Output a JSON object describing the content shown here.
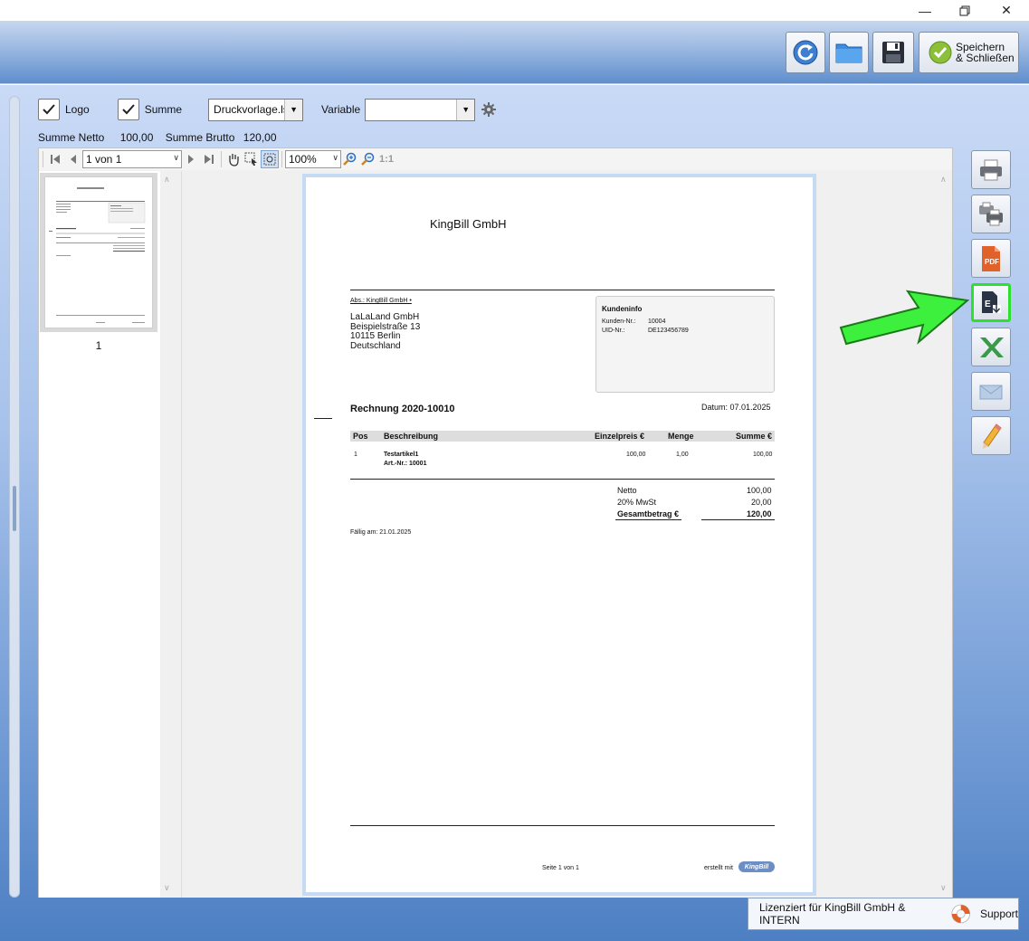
{
  "window": {
    "minimize": "—",
    "restore": "❐",
    "close": "✕"
  },
  "header": {
    "buttons": [
      "refresh-icon",
      "folder-icon",
      "save-icon"
    ],
    "save_close_line1": "Speichern",
    "save_close_line2": "& Schließen"
  },
  "options": {
    "logo_label": "Logo",
    "logo_checked": true,
    "summe_label": "Summe",
    "summe_checked": true,
    "template_value": "Druckvorlage.lst",
    "variable_label": "Variable",
    "variable_value": ""
  },
  "summary": {
    "netto_label": "Summe Netto",
    "netto_value": "100,00",
    "brutto_label": "Summe Brutto",
    "brutto_value": "120,00"
  },
  "preview_toolbar": {
    "page_value": "1 von 1",
    "zoom_value": "100%",
    "one_to_one": "1:1"
  },
  "thumbnails": {
    "page_number": "1"
  },
  "invoice": {
    "company": "KingBill GmbH",
    "sender_line": "Abs.: KingBill GmbH •",
    "recipient": [
      "LaLaLand GmbH",
      "Beispielstraße 13",
      "10115 Berlin",
      "Deutschland"
    ],
    "kundeninfo_title": "Kundeninfo",
    "kunden_nr_label": "Kunden-Nr.:",
    "kunden_nr_value": "10004",
    "uid_label": "UID-Nr.:",
    "uid_value": "DE123456789",
    "title": "Rechnung 2020-10010",
    "date": "Datum: 07.01.2025",
    "columns": [
      "Pos",
      "Beschreibung",
      "Einzelpreis €",
      "Menge",
      "Summe €"
    ],
    "rows": [
      {
        "pos": "1",
        "name": "Testartikel1",
        "art_nr": "Art.-Nr.: 10001",
        "price": "100,00",
        "qty": "1,00",
        "sum": "100,00"
      }
    ],
    "netto_label": "Netto",
    "netto_value": "100,00",
    "mwst_label": "20% MwSt",
    "mwst_value": "20,00",
    "total_label": "Gesamtbetrag €",
    "total_value": "120,00",
    "due": "Fällig am: 21.01.2025",
    "footer_page": "Seite 1 von 1",
    "footer_created": "erstellt mit",
    "footer_brand": "KingBill"
  },
  "side_buttons": [
    "printer-icon",
    "multi-printer-icon",
    "pdf-icon",
    "export-icon",
    "excel-icon",
    "email-icon",
    "edit-icon"
  ],
  "footer": {
    "license": "Lizenziert für KingBill GmbH & INTERN",
    "support": "Support"
  },
  "colors": {
    "highlight_green": "#2ee02e",
    "header_blue": "#5f8ecd"
  }
}
